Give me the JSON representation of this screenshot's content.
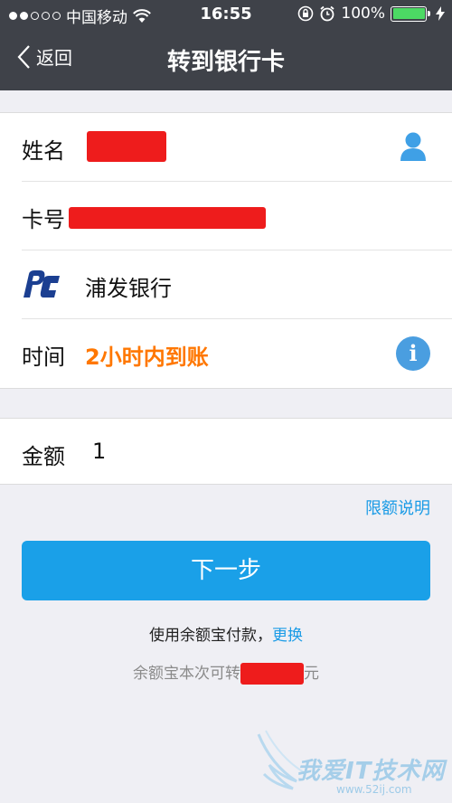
{
  "status_bar": {
    "carrier": "中国移动",
    "time": "16:55",
    "battery": "100%",
    "battery_level": 1.0
  },
  "nav": {
    "back_label": "返回",
    "title": "转到银行卡"
  },
  "form": {
    "name_label": "姓名",
    "card_label": "卡号",
    "bank_name": "浦发银行",
    "time_label": "时间",
    "time_value": "2小时内到账",
    "info_icon_glyph": "i"
  },
  "amount": {
    "label": "金额",
    "value": "1"
  },
  "limit_link": "限额说明",
  "next_button": "下一步",
  "payment": {
    "text": "使用余额宝付款，",
    "change_link": "更换"
  },
  "available": {
    "prefix": "余额宝本次可转",
    "suffix": "元"
  },
  "watermark": {
    "text": "我爱IT技术网",
    "sub": "www.52ij.com"
  },
  "colors": {
    "nav_bg": "#3f4249",
    "accent": "#1aa0e8",
    "orange": "#ff7700",
    "redaction": "#ee1c1c",
    "battery": "#4cd964"
  },
  "icons": [
    "back-chevron-icon",
    "wifi-icon",
    "lock-rotation-icon",
    "alarm-icon",
    "battery-icon",
    "charging-icon",
    "contact-person-icon",
    "spdb-bank-logo",
    "info-icon"
  ]
}
